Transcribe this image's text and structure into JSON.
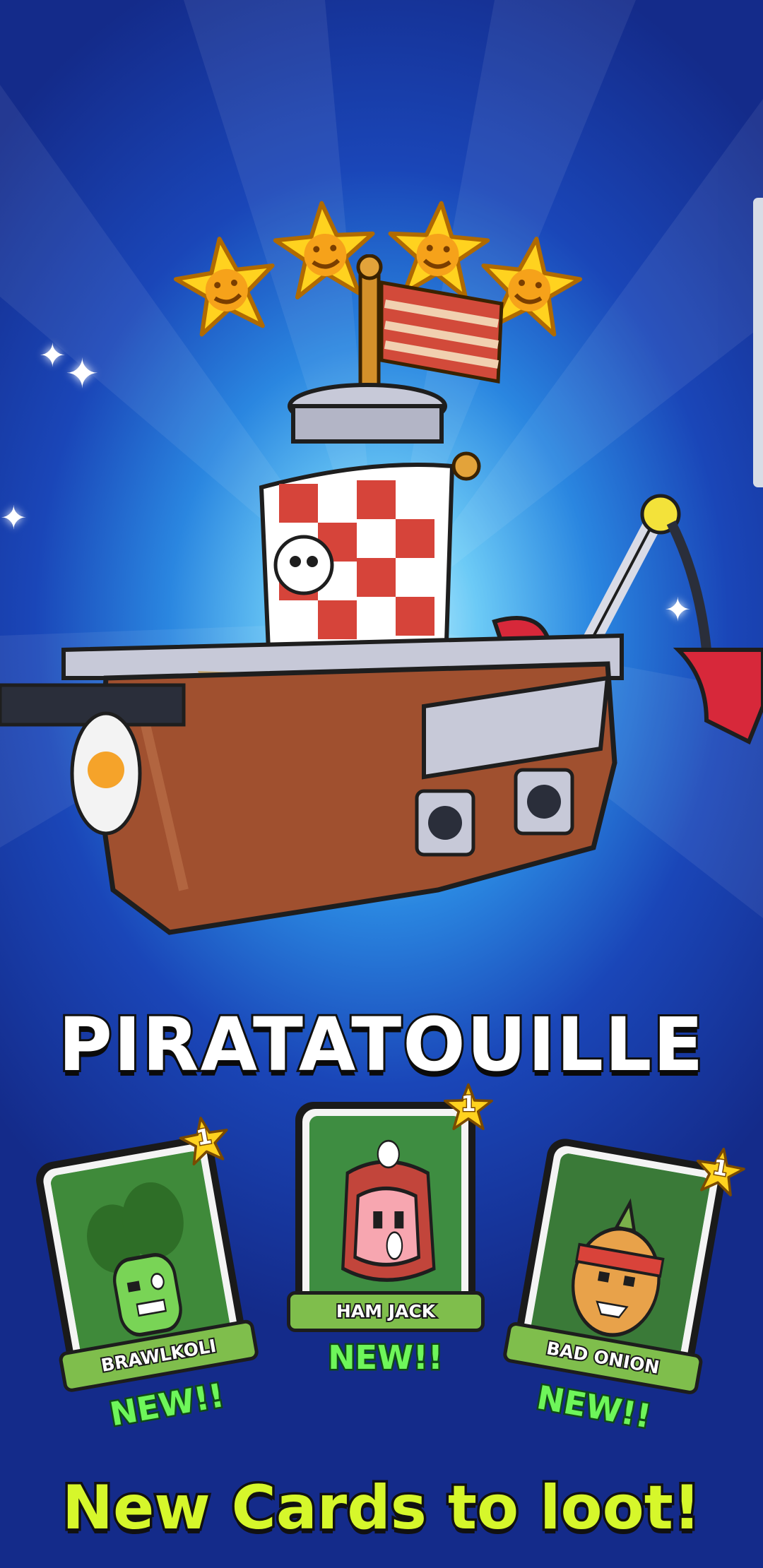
{
  "reward": {
    "title": "PIRATATOUILLE",
    "stars_count": 4,
    "cta": "New Cards to loot!"
  },
  "cards": [
    {
      "name": "BRAWLKOLI",
      "level": "1",
      "new_label": "NEW!!",
      "art_color": "#3f8a3a"
    },
    {
      "name": "HAM JACK",
      "level": "1",
      "new_label": "NEW!!",
      "art_color": "#3e8d41"
    },
    {
      "name": "BAD ONION",
      "level": "1",
      "new_label": "NEW!!",
      "art_color": "#3a7a38"
    }
  ],
  "colors": {
    "title_fill": "#ffffff",
    "cta_fill": "#d6f72b",
    "new_fill": "#6ef65a",
    "plate_green": "#7fbe4c",
    "star_yellow": "#ffd21f"
  },
  "icons": [
    "star-face-icon",
    "pirate-ship-icon",
    "sparkle-icon",
    "level-star-icon"
  ]
}
